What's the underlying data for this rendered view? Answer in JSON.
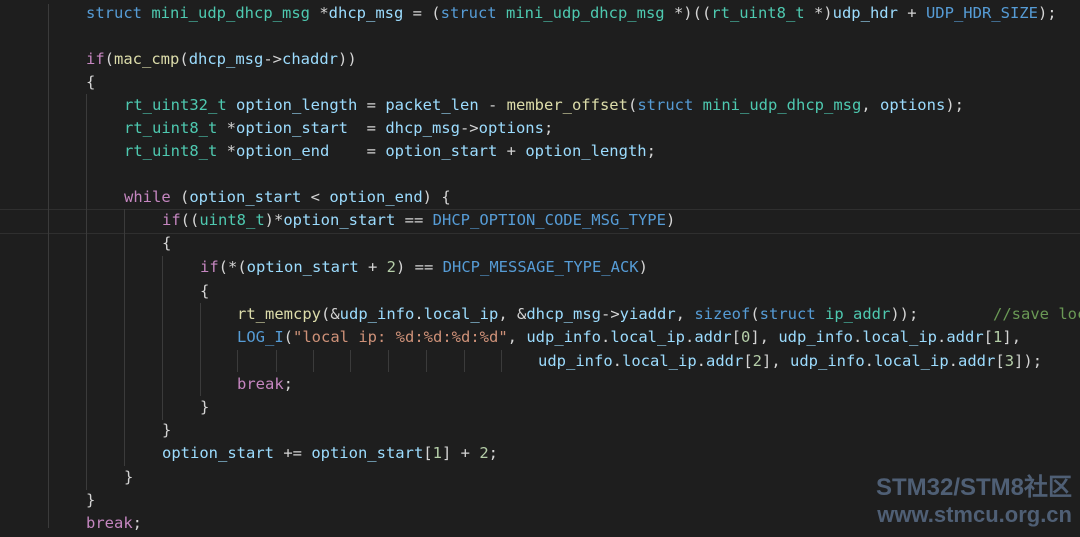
{
  "editor": {
    "background": "#1e1e1e",
    "lines": [
      [
        [
          "kw",
          "struct"
        ],
        [
          "op",
          " "
        ],
        [
          "type",
          "mini_udp_dhcp_msg"
        ],
        [
          "op",
          " *"
        ],
        [
          "var",
          "dhcp_msg"
        ],
        [
          "op",
          " = ("
        ],
        [
          "kw",
          "struct"
        ],
        [
          "op",
          " "
        ],
        [
          "type",
          "mini_udp_dhcp_msg"
        ],
        [
          "op",
          " *)(("
        ],
        [
          "type",
          "rt_uint8_t"
        ],
        [
          "op",
          " *)"
        ],
        [
          "var",
          "udp_hdr"
        ],
        [
          "op",
          " + "
        ],
        [
          "mac",
          "UDP_HDR_SIZE"
        ],
        [
          "op",
          ");"
        ]
      ],
      [],
      [
        [
          "ctl",
          "if"
        ],
        [
          "op",
          "("
        ],
        [
          "fn",
          "mac_cmp"
        ],
        [
          "op",
          "("
        ],
        [
          "var",
          "dhcp_msg"
        ],
        [
          "op",
          "->"
        ],
        [
          "var",
          "chaddr"
        ],
        [
          "op",
          "))"
        ]
      ],
      [
        [
          "op",
          "{"
        ]
      ],
      [
        [
          "type",
          "rt_uint32_t"
        ],
        [
          "op",
          " "
        ],
        [
          "var",
          "option_length"
        ],
        [
          "op",
          " = "
        ],
        [
          "var",
          "packet_len"
        ],
        [
          "op",
          " - "
        ],
        [
          "fn",
          "member_offset"
        ],
        [
          "op",
          "("
        ],
        [
          "kw",
          "struct"
        ],
        [
          "op",
          " "
        ],
        [
          "type",
          "mini_udp_dhcp_msg"
        ],
        [
          "op",
          ", "
        ],
        [
          "var",
          "options"
        ],
        [
          "op",
          ");"
        ]
      ],
      [
        [
          "type",
          "rt_uint8_t"
        ],
        [
          "op",
          " *"
        ],
        [
          "var",
          "option_start"
        ],
        [
          "op",
          "  = "
        ],
        [
          "var",
          "dhcp_msg"
        ],
        [
          "op",
          "->"
        ],
        [
          "var",
          "options"
        ],
        [
          "op",
          ";"
        ]
      ],
      [
        [
          "type",
          "rt_uint8_t"
        ],
        [
          "op",
          " *"
        ],
        [
          "var",
          "option_end"
        ],
        [
          "op",
          "    = "
        ],
        [
          "var",
          "option_start"
        ],
        [
          "op",
          " + "
        ],
        [
          "var",
          "option_length"
        ],
        [
          "op",
          ";"
        ]
      ],
      [],
      [
        [
          "ctl",
          "while"
        ],
        [
          "op",
          " ("
        ],
        [
          "var",
          "option_start"
        ],
        [
          "op",
          " < "
        ],
        [
          "var",
          "option_end"
        ],
        [
          "op",
          ") {"
        ]
      ],
      [
        [
          "ctl",
          "if"
        ],
        [
          "op",
          "(("
        ],
        [
          "type",
          "uint8_t"
        ],
        [
          "op",
          ")*"
        ],
        [
          "var",
          "option_start"
        ],
        [
          "op",
          " == "
        ],
        [
          "mac",
          "DHCP_OPTION_CODE_MSG_TYPE"
        ],
        [
          "op",
          ")"
        ]
      ],
      [
        [
          "op",
          "{"
        ]
      ],
      [
        [
          "ctl",
          "if"
        ],
        [
          "op",
          "(*("
        ],
        [
          "var",
          "option_start"
        ],
        [
          "op",
          " + "
        ],
        [
          "num",
          "2"
        ],
        [
          "op",
          ") == "
        ],
        [
          "mac",
          "DHCP_MESSAGE_TYPE_ACK"
        ],
        [
          "op",
          ")"
        ]
      ],
      [
        [
          "op",
          "{"
        ]
      ],
      [
        [
          "fn",
          "rt_memcpy"
        ],
        [
          "op",
          "(&"
        ],
        [
          "var",
          "udp_info"
        ],
        [
          "op",
          "."
        ],
        [
          "var",
          "local_ip"
        ],
        [
          "op",
          ", &"
        ],
        [
          "var",
          "dhcp_msg"
        ],
        [
          "op",
          "->"
        ],
        [
          "var",
          "yiaddr"
        ],
        [
          "op",
          ", "
        ],
        [
          "kw",
          "sizeof"
        ],
        [
          "op",
          "("
        ],
        [
          "kw",
          "struct"
        ],
        [
          "op",
          " "
        ],
        [
          "type",
          "ip_addr"
        ],
        [
          "op",
          "));        "
        ],
        [
          "cmt",
          "//save local ip"
        ]
      ],
      [
        [
          "mac",
          "LOG_I"
        ],
        [
          "op",
          "("
        ],
        [
          "str",
          "\"local ip: %d:%d:%d:%d\""
        ],
        [
          "op",
          ", "
        ],
        [
          "var",
          "udp_info"
        ],
        [
          "op",
          "."
        ],
        [
          "var",
          "local_ip"
        ],
        [
          "op",
          "."
        ],
        [
          "var",
          "addr"
        ],
        [
          "op",
          "["
        ],
        [
          "num",
          "0"
        ],
        [
          "op",
          "], "
        ],
        [
          "var",
          "udp_info"
        ],
        [
          "op",
          "."
        ],
        [
          "var",
          "local_ip"
        ],
        [
          "op",
          "."
        ],
        [
          "var",
          "addr"
        ],
        [
          "op",
          "["
        ],
        [
          "num",
          "1"
        ],
        [
          "op",
          "],"
        ]
      ],
      [
        [
          "var",
          "udp_info"
        ],
        [
          "op",
          "."
        ],
        [
          "var",
          "local_ip"
        ],
        [
          "op",
          "."
        ],
        [
          "var",
          "addr"
        ],
        [
          "op",
          "["
        ],
        [
          "num",
          "2"
        ],
        [
          "op",
          "], "
        ],
        [
          "var",
          "udp_info"
        ],
        [
          "op",
          "."
        ],
        [
          "var",
          "local_ip"
        ],
        [
          "op",
          "."
        ],
        [
          "var",
          "addr"
        ],
        [
          "op",
          "["
        ],
        [
          "num",
          "3"
        ],
        [
          "op",
          "]);"
        ]
      ],
      [
        [
          "ctl",
          "break"
        ],
        [
          "op",
          ";"
        ]
      ],
      [
        [
          "op",
          "}"
        ]
      ],
      [
        [
          "op",
          "}"
        ]
      ],
      [
        [
          "var",
          "option_start"
        ],
        [
          "op",
          " += "
        ],
        [
          "var",
          "option_start"
        ],
        [
          "op",
          "["
        ],
        [
          "num",
          "1"
        ],
        [
          "op",
          "] + "
        ],
        [
          "num",
          "2"
        ],
        [
          "op",
          ";"
        ]
      ],
      [
        [
          "op",
          "}"
        ]
      ],
      [
        [
          "op",
          "}"
        ]
      ],
      [
        [
          "ctl",
          "break"
        ],
        [
          "op",
          ";"
        ]
      ]
    ]
  },
  "watermark": {
    "line1": "STM32/STM8社区",
    "line2": "www.stmcu.org.cn"
  }
}
